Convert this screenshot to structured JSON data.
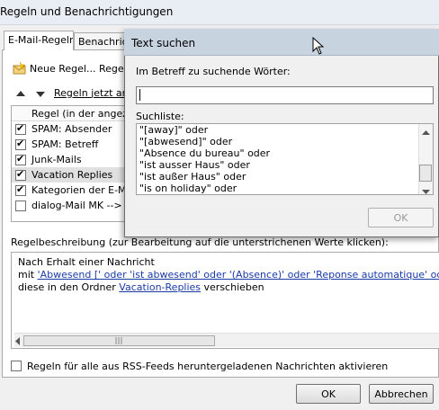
{
  "main": {
    "title": "Regeln und Benachrichtigungen",
    "tabs": [
      "E-Mail-Regeln",
      "Benachrichtigungen"
    ],
    "toolbar": {
      "new_rule": "Neue Regel...",
      "change_rule": "Regel ändern"
    },
    "toolbar2": {
      "run_rules": "Regeln jetzt anwenden"
    },
    "list_header": "Regel (in der angezeigten Reihenfolge angewendet)",
    "rules": [
      {
        "label": "SPAM: Absender",
        "checked": true
      },
      {
        "label": "SPAM: Betreff",
        "checked": true
      },
      {
        "label": "Junk-Mails",
        "checked": true
      },
      {
        "label": "Vacation Replies",
        "checked": true,
        "selected": true
      },
      {
        "label": "Kategorien der E-Mails",
        "checked": true
      },
      {
        "label": "dialog-Mail MK --> sent",
        "checked": false
      }
    ],
    "desc_label": "Regelbeschreibung (zur Bearbeitung auf die unterstrichenen Werte klicken):",
    "desc": {
      "line1": "Nach Erhalt einer Nachricht",
      "line2_prefix": "mit ",
      "line2_link": "'Abwesend [' oder 'ist abwesend' oder '(Absence)' oder 'Reponse automatique' oder 'Réponse automatique'",
      "line3_prefix": "diese in den Ordner ",
      "line3_link": "Vacation-Replies",
      "line3_suffix": " verschieben"
    },
    "rss_label": "Regeln für alle aus RSS-Feeds heruntergeladenen Nachrichten aktivieren",
    "ok": "OK",
    "cancel": "Abbrechen"
  },
  "find": {
    "title": "Text suchen",
    "subject_label": "Im Betreff zu suchende Wörter:",
    "input_value": "",
    "list_label": "Suchliste:",
    "items": [
      "\"[away]\" oder",
      "\"[abwesend]\" oder",
      "\"Absence du bureau\" oder",
      "\"ist ausser Haus\" oder",
      "\"ist außer Haus\" oder",
      "\"is on holiday\" oder"
    ],
    "ok": "OK"
  }
}
